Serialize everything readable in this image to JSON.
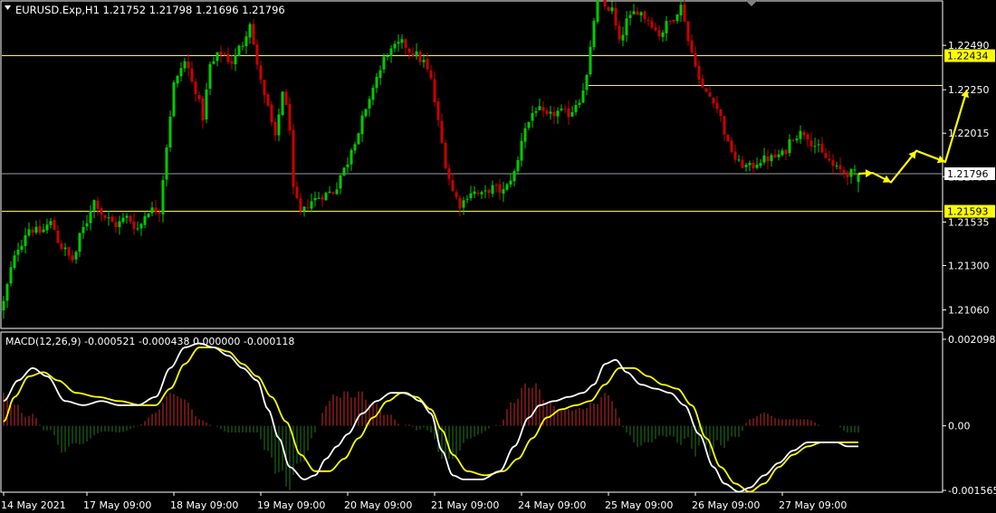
{
  "header": {
    "symbol_line": "EURUSD.Exp,H1  1.21752 1.21798 1.21696 1.21796"
  },
  "colors": {
    "background": "#000000",
    "frame": "#ffffff",
    "bull": "#00cc00",
    "bear": "#cc0000",
    "level_line": "#ffff00",
    "price_line": "#9aa0aa",
    "macd_line": "#ffffff",
    "signal_line": "#ffff00",
    "hist_positive": "#cc2a2a",
    "hist_negative": "#1f7a1f",
    "forecast_arrow": "#ffff00",
    "axis_text": "#ffffff",
    "label_bg": "#ffff00",
    "label_text": "#000000"
  },
  "chart_data": [
    {
      "type": "candlestick",
      "title": "EURUSD.Exp,H1",
      "ohlc_last": {
        "open": 1.21752,
        "high": 1.21798,
        "low": 1.21696,
        "close": 1.21796
      },
      "ylim": [
        1.2096,
        1.2273
      ],
      "y_ticks": [
        "1.22490",
        "1.22250",
        "1.22015",
        "1.21780",
        "1.21535",
        "1.21300",
        "1.21060"
      ],
      "x_tick_labels": [
        "14 May 2021",
        "17 May 09:00",
        "18 May 09:00",
        "19 May 09:00",
        "20 May 09:00",
        "21 May 09:00",
        "24 May 09:00",
        "25 May 09:00",
        "26 May 09:00",
        "27 May 09:00"
      ],
      "x_tick_candles": [
        0,
        23,
        47,
        71,
        95,
        119,
        143,
        167,
        191,
        215
      ],
      "levels": [
        {
          "price": 1.22434,
          "label": "1.22434",
          "from_candle": 0
        },
        {
          "price": 1.22273,
          "label": "",
          "from_candle": 162
        },
        {
          "price": 1.21593,
          "label": "1.21593",
          "from_candle": 0
        }
      ],
      "current_price": {
        "price": 1.21796,
        "label": "1.21796"
      },
      "close_anchors": [
        [
          0,
          1.211
        ],
        [
          2,
          1.2128
        ],
        [
          4,
          1.214
        ],
        [
          7,
          1.215
        ],
        [
          10,
          1.2148
        ],
        [
          13,
          1.2153
        ],
        [
          16,
          1.214
        ],
        [
          19,
          1.2133
        ],
        [
          22,
          1.215
        ],
        [
          25,
          1.2165
        ],
        [
          28,
          1.2156
        ],
        [
          31,
          1.2152
        ],
        [
          34,
          1.2156
        ],
        [
          37,
          1.215
        ],
        [
          40,
          1.216
        ],
        [
          43,
          1.216
        ],
        [
          45,
          1.2195
        ],
        [
          47,
          1.2228
        ],
        [
          50,
          1.224
        ],
        [
          53,
          1.2225
        ],
        [
          55,
          1.221
        ],
        [
          57,
          1.2238
        ],
        [
          60,
          1.2245
        ],
        [
          63,
          1.224
        ],
        [
          66,
          1.225
        ],
        [
          68,
          1.2262
        ],
        [
          70,
          1.2237
        ],
        [
          73,
          1.2215
        ],
        [
          75,
          1.2198
        ],
        [
          77,
          1.2225
        ],
        [
          79,
          1.2205
        ],
        [
          80,
          1.217
        ],
        [
          82,
          1.2158
        ],
        [
          85,
          1.2165
        ],
        [
          88,
          1.2168
        ],
        [
          91,
          1.217
        ],
        [
          94,
          1.2182
        ],
        [
          97,
          1.2198
        ],
        [
          100,
          1.2213
        ],
        [
          103,
          1.2232
        ],
        [
          106,
          1.2245
        ],
        [
          110,
          1.225
        ],
        [
          113,
          1.2245
        ],
        [
          116,
          1.224
        ],
        [
          118,
          1.223
        ],
        [
          120,
          1.2207
        ],
        [
          122,
          1.2185
        ],
        [
          124,
          1.217
        ],
        [
          126,
          1.2163
        ],
        [
          129,
          1.217
        ],
        [
          132,
          1.2168
        ],
        [
          135,
          1.2172
        ],
        [
          138,
          1.217
        ],
        [
          141,
          1.218
        ],
        [
          144,
          1.2205
        ],
        [
          147,
          1.2215
        ],
        [
          150,
          1.221
        ],
        [
          153,
          1.2213
        ],
        [
          156,
          1.2212
        ],
        [
          159,
          1.222
        ],
        [
          161,
          1.2232
        ],
        [
          162,
          1.2246
        ],
        [
          164,
          1.228
        ],
        [
          166,
          1.227
        ],
        [
          168,
          1.2268
        ],
        [
          170,
          1.225
        ],
        [
          172,
          1.2262
        ],
        [
          175,
          1.2268
        ],
        [
          178,
          1.2263
        ],
        [
          181,
          1.2255
        ],
        [
          184,
          1.2262
        ],
        [
          187,
          1.227
        ],
        [
          190,
          1.2245
        ],
        [
          193,
          1.2225
        ],
        [
          196,
          1.222
        ],
        [
          198,
          1.221
        ],
        [
          200,
          1.2195
        ],
        [
          203,
          1.2185
        ],
        [
          206,
          1.2183
        ],
        [
          209,
          1.2187
        ],
        [
          212,
          1.2188
        ],
        [
          215,
          1.219
        ],
        [
          218,
          1.22
        ],
        [
          221,
          1.2202
        ],
        [
          224,
          1.2195
        ],
        [
          227,
          1.2188
        ],
        [
          230,
          1.2182
        ],
        [
          233,
          1.218
        ],
        [
          236,
          1.21796
        ]
      ],
      "forecast_path": [
        [
          236,
          1.21796
        ],
        [
          240,
          1.218
        ],
        [
          245,
          1.2175
        ],
        [
          252,
          1.2192
        ],
        [
          260,
          1.2186
        ],
        [
          266,
          1.2225
        ]
      ]
    },
    {
      "type": "line",
      "title": "MACD(12,26,9) -0.000521 -0.000438 0.000000 -0.000118",
      "ylim": [
        -0.001565,
        0.002098
      ],
      "y_ticks": [
        "0.002098",
        "0.00",
        "-0.001565"
      ],
      "series": [
        {
          "name": "MACD",
          "anchors": [
            [
              0,
              0.0006
            ],
            [
              4,
              0.0011
            ],
            [
              8,
              0.0014
            ],
            [
              12,
              0.0012
            ],
            [
              17,
              0.0006
            ],
            [
              22,
              0.0005
            ],
            [
              27,
              0.0006
            ],
            [
              32,
              0.0005
            ],
            [
              37,
              0.0005
            ],
            [
              42,
              0.0007
            ],
            [
              46,
              0.0014
            ],
            [
              50,
              0.0019
            ],
            [
              54,
              0.002
            ],
            [
              58,
              0.0019
            ],
            [
              62,
              0.0017
            ],
            [
              66,
              0.0014
            ],
            [
              70,
              0.0011
            ],
            [
              73,
              0.0004
            ],
            [
              76,
              -0.0003
            ],
            [
              79,
              -0.001
            ],
            [
              83,
              -0.0013
            ],
            [
              86,
              -0.0012
            ],
            [
              89,
              -0.0008
            ],
            [
              92,
              -0.0005
            ],
            [
              95,
              -0.0002
            ],
            [
              99,
              0.0003
            ],
            [
              103,
              0.0006
            ],
            [
              107,
              0.0008
            ],
            [
              111,
              0.0008
            ],
            [
              115,
              0.0006
            ],
            [
              118,
              0.0003
            ],
            [
              121,
              -0.0006
            ],
            [
              124,
              -0.0012
            ],
            [
              127,
              -0.0013
            ],
            [
              132,
              -0.0013
            ],
            [
              137,
              -0.0011
            ],
            [
              141,
              -0.0005
            ],
            [
              145,
              0.0002
            ],
            [
              148,
              0.0005
            ],
            [
              152,
              0.0006
            ],
            [
              156,
              0.0007
            ],
            [
              160,
              0.0008
            ],
            [
              163,
              0.001
            ],
            [
              166,
              0.0015
            ],
            [
              169,
              0.0016
            ],
            [
              172,
              0.0013
            ],
            [
              176,
              0.001
            ],
            [
              180,
              0.0009
            ],
            [
              184,
              0.0008
            ],
            [
              188,
              0.0005
            ],
            [
              192,
              -0.0002
            ],
            [
              196,
              -0.001
            ],
            [
              199,
              -0.0014
            ],
            [
              203,
              -0.0016
            ],
            [
              206,
              -0.0015
            ],
            [
              210,
              -0.0012
            ],
            [
              214,
              -0.0009
            ],
            [
              218,
              -0.0006
            ],
            [
              222,
              -0.0004
            ],
            [
              226,
              -0.0004
            ],
            [
              230,
              -0.0004
            ],
            [
              233,
              -0.0005
            ],
            [
              236,
              -0.0005
            ]
          ]
        },
        {
          "name": "Signal",
          "anchors": [
            [
              0,
              0.0001
            ],
            [
              3,
              0.0007
            ],
            [
              7,
              0.0012
            ],
            [
              11,
              0.0013
            ],
            [
              15,
              0.0011
            ],
            [
              20,
              0.0008
            ],
            [
              26,
              0.0007
            ],
            [
              32,
              0.0006
            ],
            [
              38,
              0.0005
            ],
            [
              42,
              0.0005
            ],
            [
              46,
              0.0009
            ],
            [
              50,
              0.0015
            ],
            [
              54,
              0.0019
            ],
            [
              58,
              0.0019
            ],
            [
              62,
              0.0018
            ],
            [
              66,
              0.0015
            ],
            [
              70,
              0.0012
            ],
            [
              74,
              0.0007
            ],
            [
              78,
              0.0001
            ],
            [
              82,
              -0.0007
            ],
            [
              86,
              -0.0011
            ],
            [
              90,
              -0.0011
            ],
            [
              94,
              -0.0008
            ],
            [
              98,
              -0.0003
            ],
            [
              102,
              0.0002
            ],
            [
              106,
              0.0006
            ],
            [
              110,
              0.0008
            ],
            [
              114,
              0.0007
            ],
            [
              118,
              0.0004
            ],
            [
              121,
              -0.0001
            ],
            [
              124,
              -0.0007
            ],
            [
              128,
              -0.0011
            ],
            [
              133,
              -0.0012
            ],
            [
              138,
              -0.0011
            ],
            [
              142,
              -0.0008
            ],
            [
              146,
              -0.0003
            ],
            [
              150,
              0.0002
            ],
            [
              154,
              0.0004
            ],
            [
              158,
              0.0005
            ],
            [
              162,
              0.0006
            ],
            [
              166,
              0.001
            ],
            [
              170,
              0.0014
            ],
            [
              174,
              0.0014
            ],
            [
              178,
              0.0012
            ],
            [
              182,
              0.001
            ],
            [
              186,
              0.0009
            ],
            [
              190,
              0.0005
            ],
            [
              194,
              -0.0003
            ],
            [
              198,
              -0.001
            ],
            [
              202,
              -0.0014
            ],
            [
              206,
              -0.0016
            ],
            [
              210,
              -0.0014
            ],
            [
              214,
              -0.001
            ],
            [
              218,
              -0.0007
            ],
            [
              222,
              -0.0005
            ],
            [
              226,
              -0.0004
            ],
            [
              230,
              -0.0004
            ],
            [
              233,
              -0.0004
            ],
            [
              236,
              -0.0004
            ]
          ]
        }
      ]
    }
  ]
}
